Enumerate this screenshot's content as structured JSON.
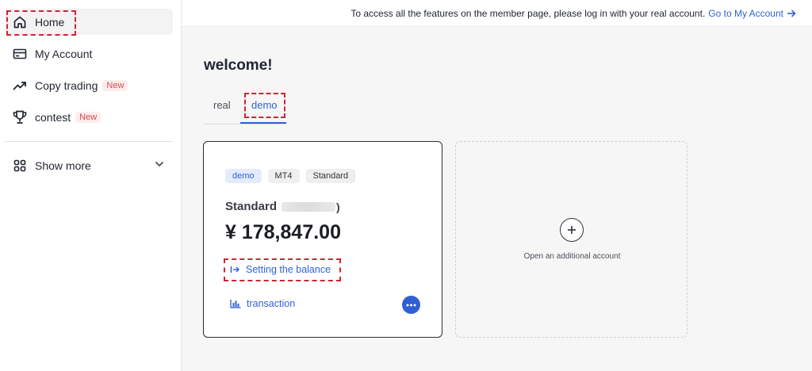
{
  "sidebar": {
    "items": [
      {
        "label": "Home",
        "icon": "home-icon"
      },
      {
        "label": "My Account",
        "icon": "card-icon"
      },
      {
        "label": "Copy trading",
        "icon": "trending-up-icon",
        "badge": "New"
      },
      {
        "label": "contest",
        "icon": "trophy-icon",
        "badge": "New"
      }
    ],
    "show_more": {
      "label": "Show more",
      "icon": "grid-icon"
    }
  },
  "topbar": {
    "message": "To access all the features on the member page, please log in with your real account.",
    "link_label": "Go to My Account"
  },
  "main": {
    "welcome": "welcome!",
    "tabs": [
      {
        "label": "real"
      },
      {
        "label": "demo",
        "active": true
      }
    ],
    "account_card": {
      "tags": [
        "demo",
        "MT4",
        "Standard"
      ],
      "name": "Standard",
      "paren": ")",
      "balance": "¥ 178,847.00",
      "setting_balance": "Setting the balance",
      "transaction": "transaction"
    },
    "add_account": {
      "label": "Open an additional account"
    }
  },
  "colors": {
    "accent": "#2f63d5",
    "highlight": "#d1242f",
    "badge_text": "#d24d4d",
    "badge_bg": "#fdecec"
  }
}
